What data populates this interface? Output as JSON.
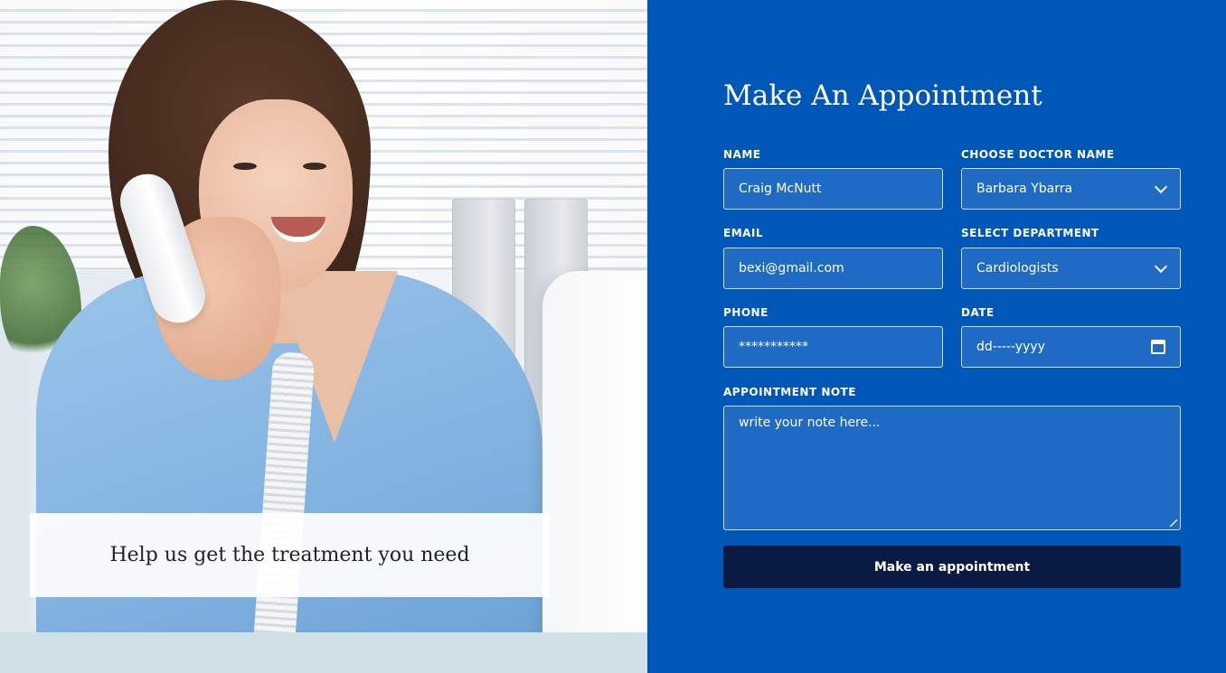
{
  "caption": "Help us get the treatment you need",
  "form": {
    "title": "Make An Appointment",
    "name": {
      "label": "NAME",
      "value": "Craig McNutt"
    },
    "doctor": {
      "label": "CHOOSE DOCTOR NAME",
      "value": "Barbara Ybarra"
    },
    "email": {
      "label": "EMAIL",
      "value": "bexi@gmail.com"
    },
    "department": {
      "label": "SELECT DEPARTMENT",
      "value": "Cardiologists"
    },
    "phone": {
      "label": "PHONE",
      "value": "***********"
    },
    "date": {
      "label": "DATE",
      "value": "dd-----yyyy"
    },
    "note": {
      "label": "APPOINTMENT NOTE",
      "placeholder": "write your note here..."
    },
    "submit_label": "Make an appointment"
  },
  "colors": {
    "panel": "#0057b8",
    "field": "#1e6ac4",
    "button": "#0a1b43"
  },
  "icons": {
    "dropdown": "chevron-down-icon",
    "date": "calendar-icon"
  }
}
